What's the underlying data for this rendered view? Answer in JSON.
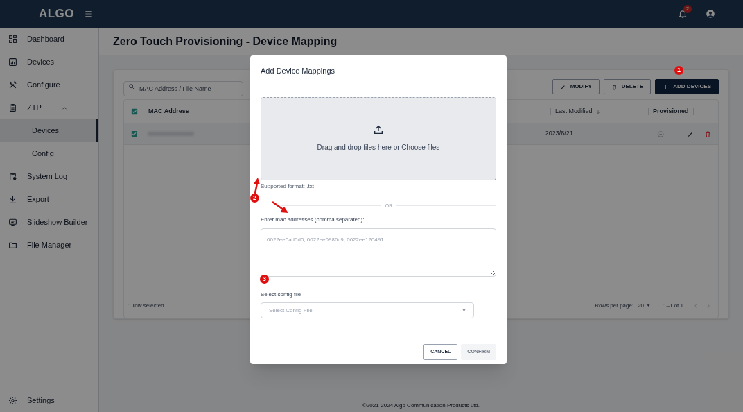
{
  "topbar": {
    "logo": "ALGO",
    "notification_count": "2"
  },
  "sidebar": {
    "items": [
      {
        "label": "Dashboard",
        "selected": false
      },
      {
        "label": "Devices",
        "selected": false
      },
      {
        "label": "Configure",
        "selected": false
      },
      {
        "label": "ZTP",
        "selected": false,
        "expanded": true,
        "children": [
          {
            "label": "Devices",
            "selected": true
          },
          {
            "label": "Config",
            "selected": false
          }
        ]
      },
      {
        "label": "System Log",
        "selected": false
      },
      {
        "label": "Export",
        "selected": false
      },
      {
        "label": "Slideshow Builder",
        "selected": false
      },
      {
        "label": "File Manager",
        "selected": false
      }
    ],
    "footer_item": {
      "label": "Settings"
    }
  },
  "page": {
    "title": "Zero Touch Provisioning - Device Mapping",
    "search": {
      "placeholder": "MAC Address / File Name"
    },
    "buttons": [
      {
        "label": "MODIFY",
        "kind": "outline"
      },
      {
        "label": "DELETE",
        "kind": "outline"
      },
      {
        "label": "ADD DEVICES",
        "kind": "primary"
      }
    ],
    "table": {
      "header_checked": true,
      "columns": [
        {
          "label": "MAC Address"
        },
        {
          "label": "Last Modified"
        },
        {
          "label": "Provisioned"
        }
      ],
      "rows": [
        {
          "selected": true,
          "last_modified": "2023/8/21",
          "provisioned": false
        }
      ],
      "footer": {
        "selection": "1 row selected",
        "rows_per_page_label": "Rows per page:",
        "rows_per_page": "20",
        "range": "1–1 of 1"
      }
    },
    "copyright": "©2021-2024 Algo Communication Products Ltd."
  },
  "modal": {
    "title": "Add Device Mappings",
    "dropzone": {
      "text": "Drag and drop files here or ",
      "link": "Choose files"
    },
    "supported": "Supported format: .txt",
    "divider": "OR",
    "mac_label": "Enter mac addresses (comma separated):",
    "mac_placeholder": "0022ee0ad5d0, 0022ee0986c9, 0022ee120491",
    "config_label": "Select config file",
    "config_placeholder": "- Select Config File -",
    "cancel": "CANCEL",
    "confirm": {
      "label": "CONFIRM",
      "disabled": true
    }
  },
  "annotations": [
    {
      "label": "1"
    },
    {
      "label": "2"
    },
    {
      "label": "3"
    }
  ]
}
